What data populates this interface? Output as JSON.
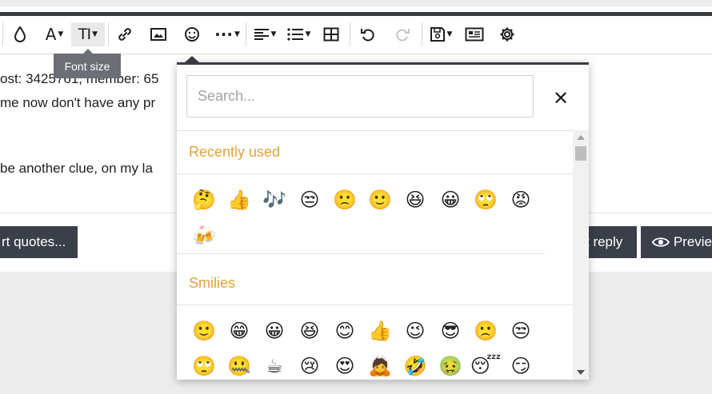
{
  "toolbar": {
    "tooltip": "Font size",
    "font_size_label": "TI",
    "font_color_label": "A",
    "more_label": "···"
  },
  "editor": {
    "line1": "ost: 3425761, member: 65",
    "line2": "me now don't have any pr",
    "line3": "be another clue, on my la"
  },
  "buttons": {
    "insert_quotes": "rt quotes...",
    "post_reply": "t reply",
    "preview": "Previe"
  },
  "emoji_panel": {
    "search_placeholder": "Search...",
    "close_glyph": "✕",
    "recent_title": "Recently used",
    "smilies_title": "Smilies",
    "recent": [
      "🤔",
      "👍",
      "🎶",
      "😒",
      "🙁",
      "🙂",
      "😆",
      "😀",
      "🙄",
      "😡",
      "🍻"
    ],
    "smilies": [
      "🙂",
      "😁",
      "😀",
      "😆",
      "😊",
      "👍",
      "😉",
      "😎",
      "🙁",
      "😒",
      "🙄",
      "🤐",
      "☕",
      "😢",
      "😍",
      "🙇",
      "🤣",
      "🤢",
      "😴",
      "😏"
    ]
  }
}
